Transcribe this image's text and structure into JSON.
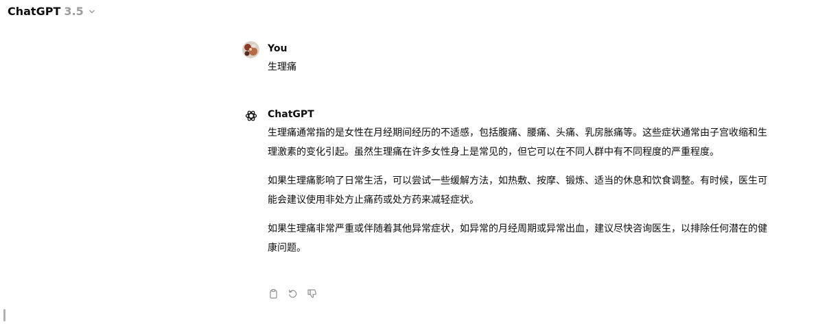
{
  "header": {
    "model_name": "ChatGPT",
    "model_version": "3.5"
  },
  "conversation": {
    "user": {
      "author": "You",
      "message": "生理痛"
    },
    "assistant": {
      "author": "ChatGPT",
      "paragraphs": [
        "生理痛通常指的是女性在月经期间经历的不适感，包括腹痛、腰痛、头痛、乳房胀痛等。这些症状通常由子宫收缩和生理激素的变化引起。虽然生理痛在许多女性身上是常见的，但它可以在不同人群中有不同程度的严重程度。",
        "如果生理痛影响了日常生活，可以尝试一些缓解方法，如热敷、按摩、锻炼、适当的休息和饮食调整。有时候，医生可能会建议使用非处方止痛药或处方药来减轻症状。",
        "如果生理痛非常严重或伴随着其他异常症状，如异常的月经周期或异常出血，建议尽快咨询医生，以排除任何潜在的健康问题。"
      ]
    }
  },
  "icons": {
    "chevron": "chevron-down-icon",
    "copy": "clipboard-icon",
    "regenerate": "refresh-icon",
    "dislike": "thumbs-down-icon",
    "bot": "openai-logo-icon"
  },
  "colors": {
    "text": "#0d0d0d",
    "muted": "#9b9b9b",
    "icon": "#8e8e8e"
  }
}
